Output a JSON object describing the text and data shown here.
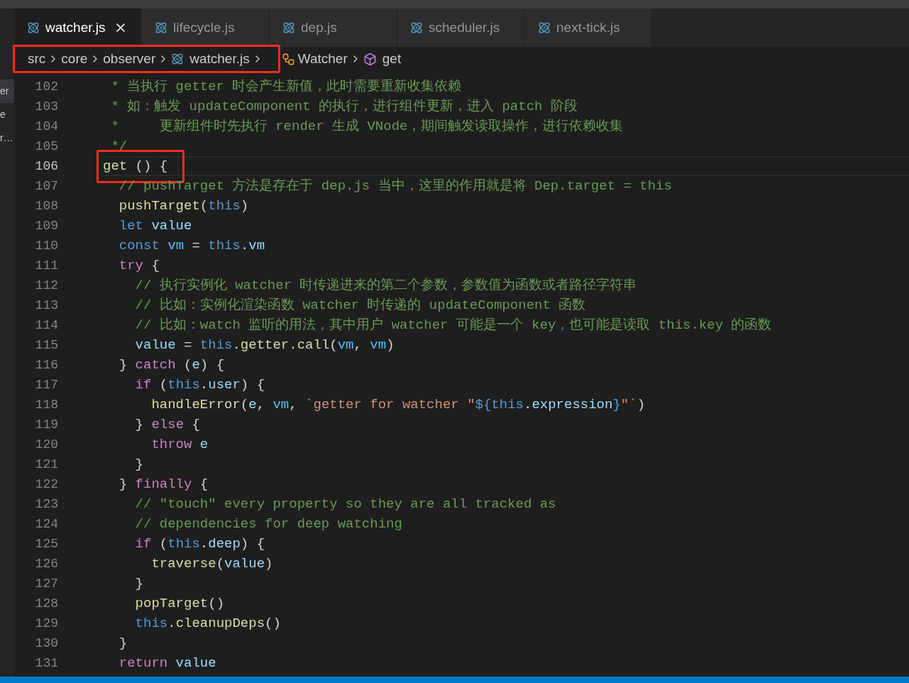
{
  "sidebar": {
    "items": [
      {
        "text": "er",
        "selected": true
      },
      {
        "text": "e",
        "selected": false
      },
      {
        "text": "r…",
        "selected": false
      }
    ]
  },
  "tabs": [
    {
      "label": "watcher.js",
      "selected": true,
      "closable": true
    },
    {
      "label": "lifecycle.js",
      "selected": false,
      "closable": false
    },
    {
      "label": "dep.js",
      "selected": false,
      "closable": false
    },
    {
      "label": "scheduler.js",
      "selected": false,
      "closable": false
    },
    {
      "label": "next-tick.js",
      "selected": false,
      "closable": false
    }
  ],
  "breadcrumb": [
    {
      "label": "src",
      "kind": "folder",
      "highlighted": true
    },
    {
      "label": "core",
      "kind": "folder",
      "highlighted": true
    },
    {
      "label": "observer",
      "kind": "folder",
      "highlighted": true
    },
    {
      "label": "watcher.js",
      "kind": "file",
      "highlighted": true
    },
    {
      "label": "Watcher",
      "kind": "class",
      "highlighted": false
    },
    {
      "label": "get",
      "kind": "method",
      "highlighted": false
    }
  ],
  "code": [
    {
      "number": "102",
      "current": false,
      "highlighted": false,
      "tokens": [
        {
          "kind": "comment",
          "text": " * 当执行 getter 时会产生新值，此时需要重新收集依赖"
        }
      ]
    },
    {
      "number": "103",
      "current": false,
      "highlighted": false,
      "tokens": [
        {
          "kind": "comment",
          "text": " * 如：触发 updateComponent 的执行，进行组件更新，进入 patch 阶段"
        }
      ]
    },
    {
      "number": "104",
      "current": false,
      "highlighted": false,
      "tokens": [
        {
          "kind": "comment",
          "text": " *     更新组件时先执行 render 生成 VNode，期间触发读取操作，进行依赖收集"
        }
      ]
    },
    {
      "number": "105",
      "current": false,
      "highlighted": false,
      "tokens": [
        {
          "kind": "comment",
          "text": " */"
        }
      ]
    },
    {
      "number": "106",
      "current": true,
      "highlighted": true,
      "tokens": [
        {
          "kind": "function",
          "text": "get"
        },
        {
          "kind": "plain",
          "text": " () {"
        }
      ]
    },
    {
      "number": "107",
      "current": false,
      "highlighted": false,
      "tokens": [
        {
          "kind": "comment",
          "text": "  // pushTarget 方法是存在于 dep.js 当中，这里的作用就是将 Dep.target = this"
        }
      ]
    },
    {
      "number": "108",
      "current": false,
      "highlighted": false,
      "tokens": [
        {
          "kind": "function",
          "text": "  pushTarget"
        },
        {
          "kind": "plain",
          "text": "("
        },
        {
          "kind": "declaration",
          "text": "this"
        },
        {
          "kind": "plain",
          "text": ")"
        }
      ]
    },
    {
      "number": "109",
      "current": false,
      "highlighted": false,
      "tokens": [
        {
          "kind": "declaration",
          "text": "  let"
        },
        {
          "kind": "variable",
          "text": " value"
        }
      ]
    },
    {
      "number": "110",
      "current": false,
      "highlighted": false,
      "tokens": [
        {
          "kind": "declaration",
          "text": "  const"
        },
        {
          "kind": "constant",
          "text": " vm"
        },
        {
          "kind": "plain",
          "text": " = "
        },
        {
          "kind": "declaration",
          "text": "this"
        },
        {
          "kind": "plain",
          "text": "."
        },
        {
          "kind": "variable",
          "text": "vm"
        }
      ]
    },
    {
      "number": "111",
      "current": false,
      "highlighted": false,
      "tokens": [
        {
          "kind": "keyword",
          "text": "  try"
        },
        {
          "kind": "plain",
          "text": " {"
        }
      ]
    },
    {
      "number": "112",
      "current": false,
      "highlighted": false,
      "tokens": [
        {
          "kind": "comment",
          "text": "    // 执行实例化 watcher 时传递进来的第二个参数，参数值为函数或者路径字符串"
        }
      ]
    },
    {
      "number": "113",
      "current": false,
      "highlighted": false,
      "tokens": [
        {
          "kind": "comment",
          "text": "    // 比如：实例化渲染函数 watcher 时传递的 updateComponent 函数"
        }
      ]
    },
    {
      "number": "114",
      "current": false,
      "highlighted": false,
      "tokens": [
        {
          "kind": "comment",
          "text": "    // 比如：watch 监听的用法，其中用户 watcher 可能是一个 key，也可能是读取 this.key 的函数"
        }
      ]
    },
    {
      "number": "115",
      "current": false,
      "highlighted": false,
      "tokens": [
        {
          "kind": "variable",
          "text": "    value"
        },
        {
          "kind": "plain",
          "text": " = "
        },
        {
          "kind": "declaration",
          "text": "this"
        },
        {
          "kind": "plain",
          "text": "."
        },
        {
          "kind": "function",
          "text": "getter"
        },
        {
          "kind": "plain",
          "text": "."
        },
        {
          "kind": "function",
          "text": "call"
        },
        {
          "kind": "plain",
          "text": "("
        },
        {
          "kind": "constant",
          "text": "vm"
        },
        {
          "kind": "plain",
          "text": ", "
        },
        {
          "kind": "constant",
          "text": "vm"
        },
        {
          "kind": "plain",
          "text": ")"
        }
      ]
    },
    {
      "number": "116",
      "current": false,
      "highlighted": false,
      "tokens": [
        {
          "kind": "plain",
          "text": "  } "
        },
        {
          "kind": "keyword",
          "text": "catch"
        },
        {
          "kind": "plain",
          "text": " ("
        },
        {
          "kind": "variable",
          "text": "e"
        },
        {
          "kind": "plain",
          "text": ") {"
        }
      ]
    },
    {
      "number": "117",
      "current": false,
      "highlighted": false,
      "tokens": [
        {
          "kind": "keyword",
          "text": "    if"
        },
        {
          "kind": "plain",
          "text": " ("
        },
        {
          "kind": "declaration",
          "text": "this"
        },
        {
          "kind": "plain",
          "text": "."
        },
        {
          "kind": "variable",
          "text": "user"
        },
        {
          "kind": "plain",
          "text": ") {"
        }
      ]
    },
    {
      "number": "118",
      "current": false,
      "highlighted": false,
      "tokens": [
        {
          "kind": "function",
          "text": "      handleError"
        },
        {
          "kind": "plain",
          "text": "("
        },
        {
          "kind": "variable",
          "text": "e"
        },
        {
          "kind": "plain",
          "text": ", "
        },
        {
          "kind": "constant",
          "text": "vm"
        },
        {
          "kind": "plain",
          "text": ", "
        },
        {
          "kind": "string",
          "text": "`getter for watcher \""
        },
        {
          "kind": "template",
          "text": "${"
        },
        {
          "kind": "declaration",
          "text": "this"
        },
        {
          "kind": "plain",
          "text": "."
        },
        {
          "kind": "variable",
          "text": "expression"
        },
        {
          "kind": "template",
          "text": "}"
        },
        {
          "kind": "string",
          "text": "\"`"
        },
        {
          "kind": "plain",
          "text": ")"
        }
      ]
    },
    {
      "number": "119",
      "current": false,
      "highlighted": false,
      "tokens": [
        {
          "kind": "plain",
          "text": "    } "
        },
        {
          "kind": "keyword",
          "text": "else"
        },
        {
          "kind": "plain",
          "text": " {"
        }
      ]
    },
    {
      "number": "120",
      "current": false,
      "highlighted": false,
      "tokens": [
        {
          "kind": "keyword",
          "text": "      throw"
        },
        {
          "kind": "variable",
          "text": " e"
        }
      ]
    },
    {
      "number": "121",
      "current": false,
      "highlighted": false,
      "tokens": [
        {
          "kind": "plain",
          "text": "    }"
        }
      ]
    },
    {
      "number": "122",
      "current": false,
      "highlighted": false,
      "tokens": [
        {
          "kind": "plain",
          "text": "  } "
        },
        {
          "kind": "keyword",
          "text": "finally"
        },
        {
          "kind": "plain",
          "text": " {"
        }
      ]
    },
    {
      "number": "123",
      "current": false,
      "highlighted": false,
      "tokens": [
        {
          "kind": "comment",
          "text": "    // \"touch\" every property so they are all tracked as"
        }
      ]
    },
    {
      "number": "124",
      "current": false,
      "highlighted": false,
      "tokens": [
        {
          "kind": "comment",
          "text": "    // dependencies for deep watching"
        }
      ]
    },
    {
      "number": "125",
      "current": false,
      "highlighted": false,
      "tokens": [
        {
          "kind": "keyword",
          "text": "    if"
        },
        {
          "kind": "plain",
          "text": " ("
        },
        {
          "kind": "declaration",
          "text": "this"
        },
        {
          "kind": "plain",
          "text": "."
        },
        {
          "kind": "variable",
          "text": "deep"
        },
        {
          "kind": "plain",
          "text": ") {"
        }
      ]
    },
    {
      "number": "126",
      "current": false,
      "highlighted": false,
      "tokens": [
        {
          "kind": "function",
          "text": "      traverse"
        },
        {
          "kind": "plain",
          "text": "("
        },
        {
          "kind": "variable",
          "text": "value"
        },
        {
          "kind": "plain",
          "text": ")"
        }
      ]
    },
    {
      "number": "127",
      "current": false,
      "highlighted": false,
      "tokens": [
        {
          "kind": "plain",
          "text": "    }"
        }
      ]
    },
    {
      "number": "128",
      "current": false,
      "highlighted": false,
      "tokens": [
        {
          "kind": "function",
          "text": "    popTarget"
        },
        {
          "kind": "plain",
          "text": "()"
        }
      ]
    },
    {
      "number": "129",
      "current": false,
      "highlighted": false,
      "tokens": [
        {
          "kind": "declaration",
          "text": "    this"
        },
        {
          "kind": "plain",
          "text": "."
        },
        {
          "kind": "function",
          "text": "cleanupDeps"
        },
        {
          "kind": "plain",
          "text": "()"
        }
      ]
    },
    {
      "number": "130",
      "current": false,
      "highlighted": false,
      "tokens": [
        {
          "kind": "plain",
          "text": "  }"
        }
      ]
    },
    {
      "number": "131",
      "current": false,
      "highlighted": false,
      "tokens": [
        {
          "kind": "keyword",
          "text": "  return"
        },
        {
          "kind": "variable",
          "text": " value"
        }
      ]
    }
  ]
}
